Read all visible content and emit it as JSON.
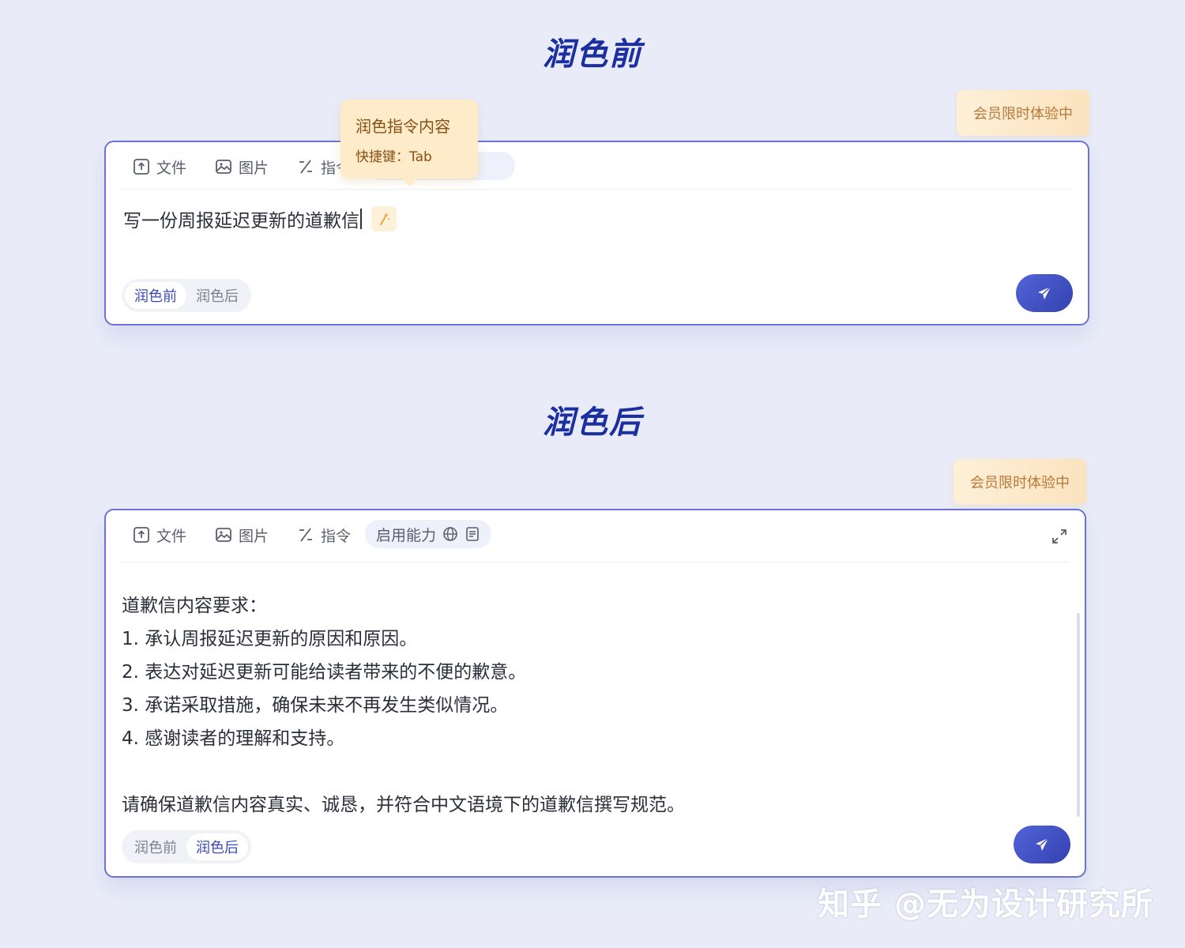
{
  "before": {
    "section_title": "润色前",
    "badge": "会员限时体验中",
    "toolbar": {
      "file_label": "文件",
      "image_label": "图片",
      "command_label": "指令"
    },
    "tooltip": {
      "title": "润色指令内容",
      "shortcut": "快捷键：Tab"
    },
    "prompt_text": "写一份周报延迟更新的道歉信",
    "mode_switch": {
      "before_label": "润色前",
      "after_label": "润色后",
      "active": "before"
    }
  },
  "after": {
    "section_title": "润色后",
    "badge": "会员限时体验中",
    "toolbar": {
      "file_label": "文件",
      "image_label": "图片",
      "command_label": "指令",
      "ability_label": "启用能力"
    },
    "result_lines": [
      "道歉信内容要求：",
      "1. 承认周报延迟更新的原因和原因。",
      "2. 表达对延迟更新可能给读者带来的不便的歉意。",
      "3. 承诺采取措施，确保未来不再发生类似情况。",
      "4. 感谢读者的理解和支持。"
    ],
    "result_footer": "请确保道歉信内容真实、诚恳，并符合中文语境下的道歉信撰写规范。",
    "mode_switch": {
      "before_label": "润色前",
      "after_label": "润色后",
      "active": "after"
    }
  },
  "watermark": "知乎 @无为设计研究所",
  "colors": {
    "background": "#e9ecf8",
    "title": "#1c2fa0",
    "card_border": "#6c72d6",
    "badge_text": "#b8793a",
    "send_button": "#3c4bc0"
  }
}
